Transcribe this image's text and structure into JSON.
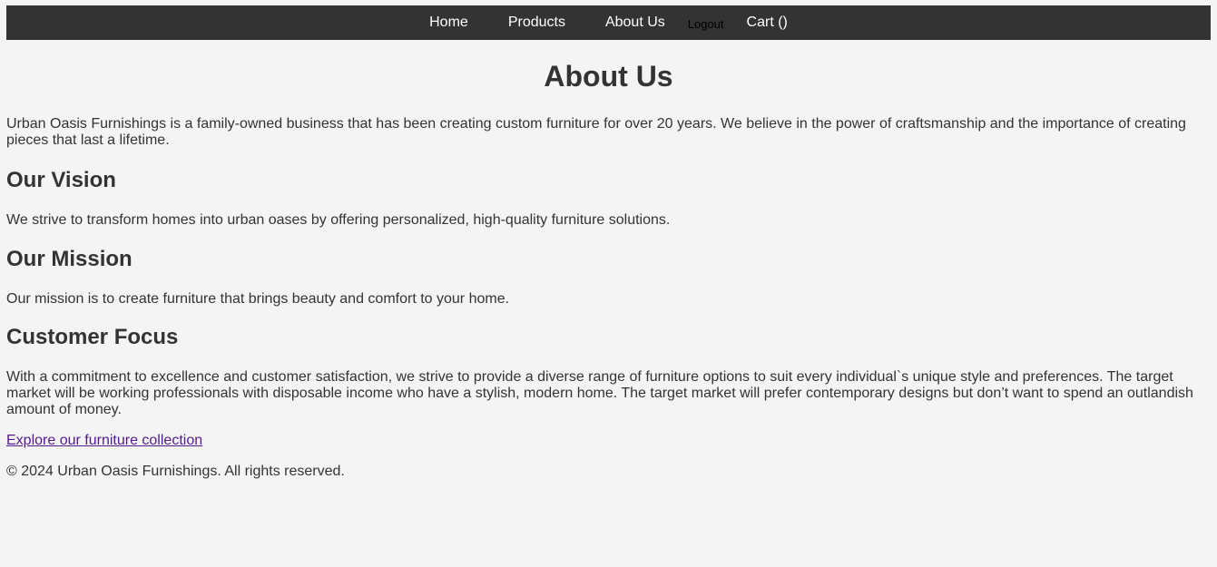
{
  "nav": {
    "home": "Home",
    "products": "Products",
    "about": "About Us",
    "logout": "Logout",
    "cart": "Cart ()"
  },
  "page": {
    "title": "About Us",
    "intro": "Urban Oasis Furnishings is a family-owned business that has been creating custom furniture for over 20 years. We believe in the power of craftsmanship and the importance of creating pieces that last a lifetime.",
    "sections": [
      {
        "heading": "Our Vision",
        "text": "We strive to transform homes into urban oases by offering personalized, high-quality furniture solutions."
      },
      {
        "heading": "Our Mission",
        "text": "Our mission is to create furniture that brings beauty and comfort to your home."
      },
      {
        "heading": "Customer Focus",
        "text": "With a commitment to excellence and customer satisfaction, we strive to provide a diverse range of furniture options to suit every individual`s unique style and preferences. The target market will be working professionals with disposable income who have a stylish, modern home. The target market will prefer contemporary designs but don’t want to spend an outlandish amount of money."
      }
    ],
    "explore_link": "Explore our furniture collection",
    "footer": "© 2024 Urban Oasis Furnishings. All rights reserved."
  },
  "colors": {
    "background": "#f4f4f4",
    "navbar": "#333333",
    "text": "#333333",
    "visited_link": "#551a8b"
  }
}
